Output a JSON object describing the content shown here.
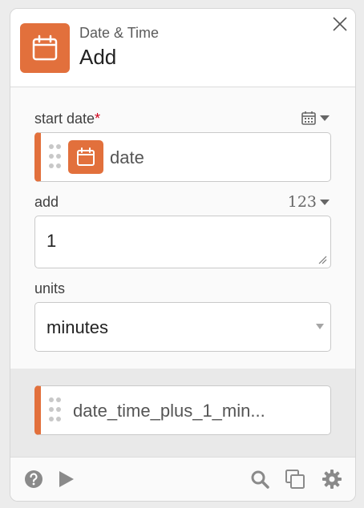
{
  "header": {
    "app_name": "Date & Time",
    "action_title": "Add"
  },
  "fields": {
    "start_date": {
      "label": "start date",
      "required_mark": "*",
      "token_text": "date",
      "type_icon": "calendar-icon"
    },
    "add": {
      "label": "add",
      "type_label": "123",
      "value": "1"
    },
    "units": {
      "label": "units",
      "selected": "minutes"
    }
  },
  "output": {
    "token_text": "date_time_plus_1_min..."
  },
  "footer": {
    "icons": [
      "help-icon",
      "play-icon",
      "search-icon",
      "duplicate-icon",
      "settings-icon"
    ]
  },
  "colors": {
    "accent": "#e2703c",
    "required": "#d0021b"
  }
}
